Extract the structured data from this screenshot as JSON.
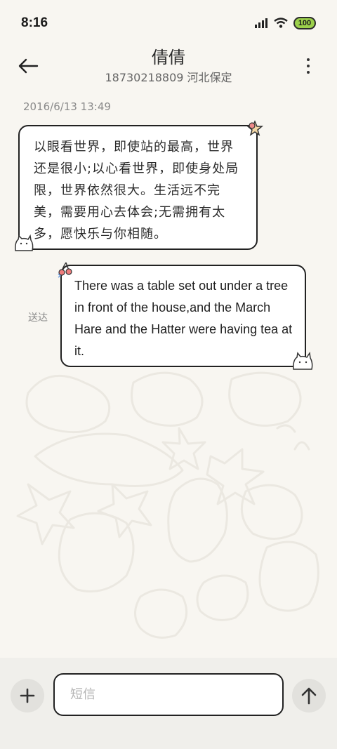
{
  "status_bar": {
    "time": "8:16",
    "battery": "100"
  },
  "header": {
    "contact_name": "倩倩",
    "contact_info": "18730218809 河北保定"
  },
  "messages": [
    {
      "direction": "incoming",
      "timestamp": "2016/6/13 13:49",
      "text": "以眼看世界，即使站的最高，世界还是很小;以心看世界，即使身处局限，世界依然很大。生活远不完美，需要用心去体会;无需拥有太多，愿快乐与你相随。"
    },
    {
      "direction": "outgoing",
      "status": "送达",
      "text": "There was a table set out under a tree in front of the house,and the March Hare and the Hatter were having tea at it."
    }
  ],
  "composer": {
    "placeholder": "短信"
  },
  "icons": {
    "back": "arrow-left-icon",
    "more": "more-vertical-icon",
    "add": "plus-icon",
    "send": "arrow-up-icon"
  },
  "colors": {
    "background": "#f8f6f1",
    "bubble_border": "#222222",
    "battery_fill": "#9cd14b",
    "bottom_bar": "#f0efeb"
  }
}
